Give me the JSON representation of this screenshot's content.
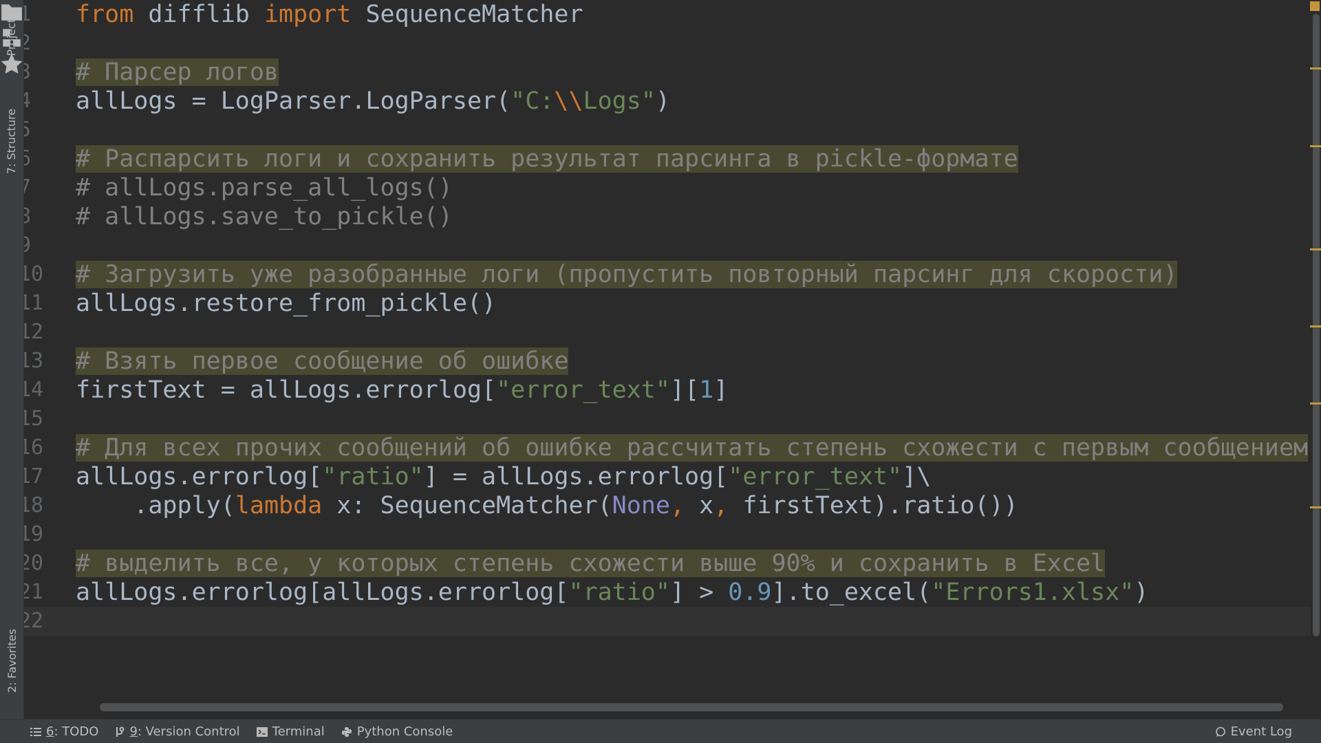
{
  "left_tools": {
    "project": "1: Project",
    "structure": "7: Structure",
    "favorites": "2: Favorites"
  },
  "editor": {
    "line_numbers": [
      "1",
      "2",
      "3",
      "4",
      "5",
      "6",
      "7",
      "8",
      "9",
      "10",
      "11",
      "12",
      "13",
      "14",
      "15",
      "16",
      "17",
      "18",
      "19",
      "20",
      "21",
      "22"
    ],
    "lines": [
      "from difflib import SequenceMatcher",
      "",
      "# Парсер логов",
      "allLogs = LogParser.LogParser(\"C:\\\\Logs\")",
      "",
      "# Распарсить логи и сохранить результат парсинга в pickle-формате",
      "# allLogs.parse_all_logs()",
      "# allLogs.save_to_pickle()",
      "",
      "# Загрузить уже разобранные логи (пропустить повторный парсинг для скорости)",
      "allLogs.restore_from_pickle()",
      "",
      "# Взять первое сообщение об ошибке",
      "firstText = allLogs.errorlog[\"error_text\"][1]",
      "",
      "# Для всех прочих сообщений об ошибке рассчитать степень схожести с первым сообщением",
      "allLogs.errorlog[\"ratio\"] = allLogs.errorlog[\"error_text\"]\\",
      "    .apply(lambda x: SequenceMatcher(None, x, firstText).ratio())",
      "",
      "# выделить все, у которых степень схожести выше 90% и сохранить в Excel",
      "allLogs.errorlog[allLogs.errorlog[\"ratio\"] > 0.9].to_excel(\"Errors1.xlsx\")",
      ""
    ],
    "current_line": 22
  },
  "bottom_tools": {
    "todo": {
      "num": "6",
      "label": ": TODO"
    },
    "vcs": {
      "num": "9",
      "label": ": Version Control"
    },
    "terminal": "Terminal",
    "python_console": "Python Console",
    "event_log": "Event Log"
  },
  "colors": {
    "background": "#2b2b2b",
    "keyword": "#cc7832",
    "string": "#6a8759",
    "number": "#6897bb",
    "comment": "#808080",
    "marker": "#bd9a3d"
  }
}
